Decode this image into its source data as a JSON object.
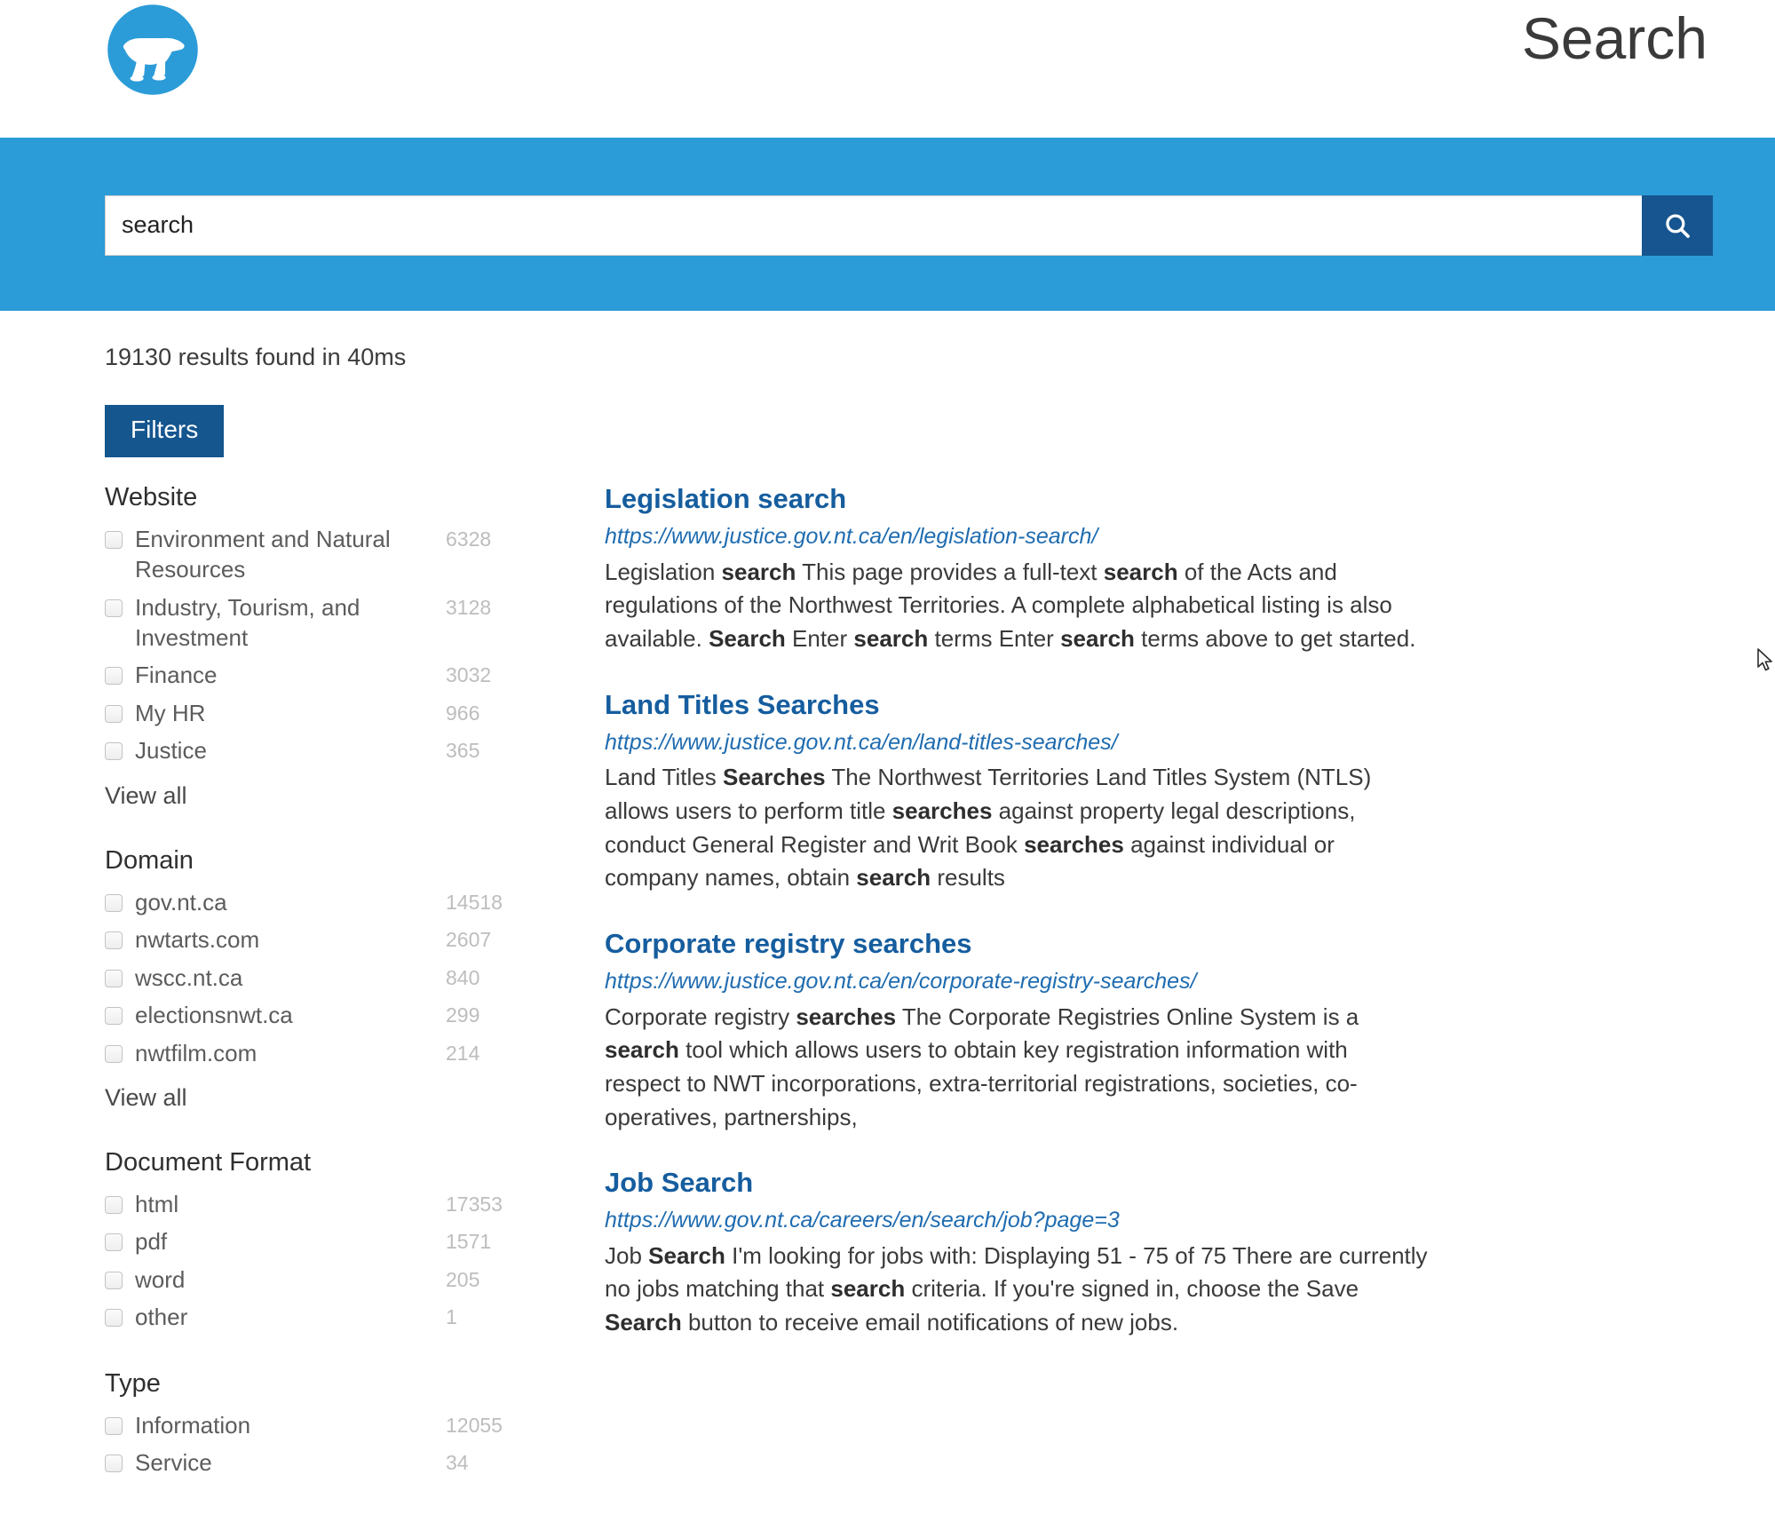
{
  "header": {
    "title": "Search",
    "logo_icon": "polar-bear-logo",
    "logo_color": "#2b9cd8"
  },
  "search": {
    "value": "search",
    "placeholder": "",
    "button_icon": "search-icon",
    "band_color": "#2b9cd8",
    "button_color": "#16558f"
  },
  "results_summary": "19130 results found in 40ms",
  "filters": {
    "button_label": "Filters",
    "button_color": "#15568f",
    "view_all_label": "View all",
    "groups": [
      {
        "title": "Website",
        "has_view_all": true,
        "items": [
          {
            "label": "Environment and Natural Resources",
            "count": "6328"
          },
          {
            "label": "Industry, Tourism, and Investment",
            "count": "3128"
          },
          {
            "label": "Finance",
            "count": "3032"
          },
          {
            "label": "My HR",
            "count": "966"
          },
          {
            "label": "Justice",
            "count": "365"
          }
        ]
      },
      {
        "title": "Domain",
        "has_view_all": true,
        "items": [
          {
            "label": "gov.nt.ca",
            "count": "14518"
          },
          {
            "label": "nwtarts.com",
            "count": "2607"
          },
          {
            "label": "wscc.nt.ca",
            "count": "840"
          },
          {
            "label": "electionsnwt.ca",
            "count": "299"
          },
          {
            "label": "nwtfilm.com",
            "count": "214"
          }
        ]
      },
      {
        "title": "Document Format",
        "has_view_all": false,
        "items": [
          {
            "label": "html",
            "count": "17353"
          },
          {
            "label": "pdf",
            "count": "1571"
          },
          {
            "label": "word",
            "count": "205"
          },
          {
            "label": "other",
            "count": "1"
          }
        ]
      },
      {
        "title": "Type",
        "has_view_all": false,
        "items": [
          {
            "label": "Information",
            "count": "12055"
          },
          {
            "label": "Service",
            "count": "34"
          }
        ]
      }
    ]
  },
  "results": [
    {
      "title": "Legislation search",
      "url": "https://www.justice.gov.nt.ca/en/legislation-search/",
      "snippet_html": "Legislation <b>search</b> This page provides a full-text <b>search</b> of the Acts and regulations of the Northwest Territories. A complete alphabetical listing is also available. <b>Search</b> Enter <b>search</b> terms Enter <b>search</b> terms above to get started."
    },
    {
      "title": "Land Titles Searches",
      "url": "https://www.justice.gov.nt.ca/en/land-titles-searches/",
      "snippet_html": "Land Titles <b>Searches</b> The Northwest Territories Land Titles System (NTLS) allows users to perform title <b>searches</b> against property legal descriptions, conduct General Register and Writ Book <b>searches</b> against individual or company names, obtain <b>search</b> results"
    },
    {
      "title": "Corporate registry searches",
      "url": "https://www.justice.gov.nt.ca/en/corporate-registry-searches/",
      "snippet_html": "Corporate registry <b>searches</b> The Corporate Registries Online System is a <b>search</b> tool which allows users to obtain key registration information with respect to NWT incorporations, extra-territorial registrations, societies, co-operatives, partnerships,"
    },
    {
      "title": "Job Search",
      "url": "https://www.gov.nt.ca/careers/en/search/job?page=3",
      "snippet_html": "Job <b>Search</b> I'm looking for jobs with: Displaying 51 - 75 of 75 There are currently no jobs matching that <b>search</b> criteria. If you're signed in, choose the Save <b>Search</b> button to receive email notifications of new jobs."
    }
  ]
}
